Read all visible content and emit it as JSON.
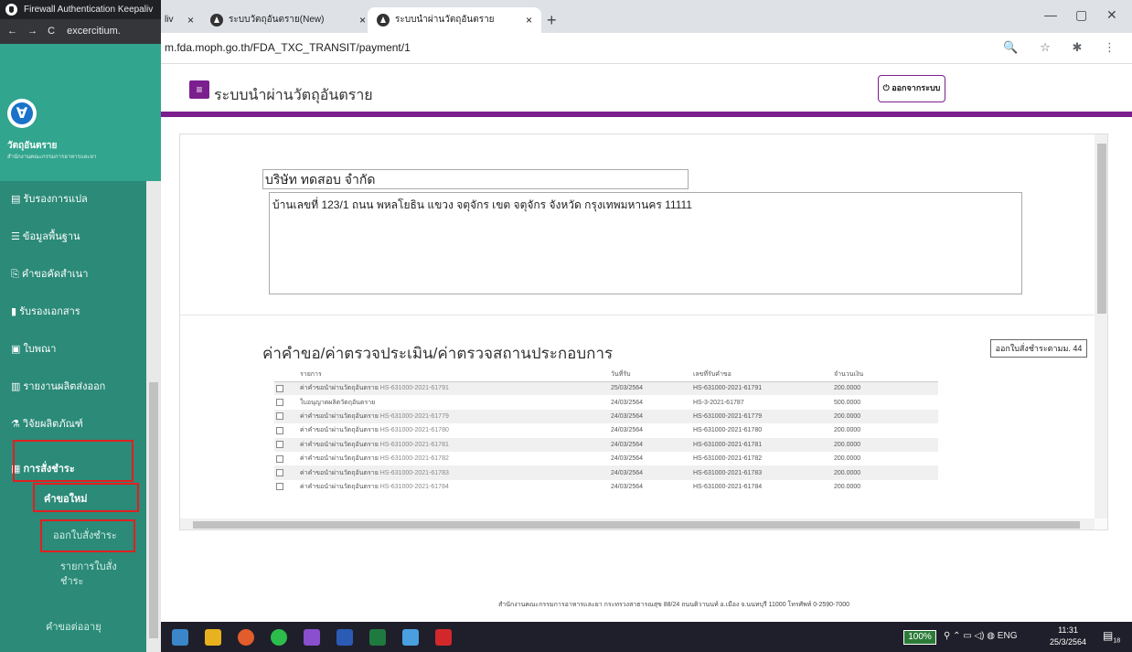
{
  "bg_window": {
    "tab_title": "Firewall Authentication Keepaliv",
    "url_fragment": "excercitium.",
    "brand_title": "วัตถุอันตราย",
    "brand_sub": "สำนักงานคณะกรรมการอาหารและยา",
    "menu": [
      {
        "label": "รับรองการแปล"
      },
      {
        "label": "ข้อมูลพื้นฐาน"
      },
      {
        "label": "คำขอคัดสำเนา"
      },
      {
        "label": "รับรองเอกสาร"
      },
      {
        "label": "ใบพณา"
      },
      {
        "label": "รายงานผลิตส่งออก"
      },
      {
        "label": "วิจัยผลิตภัณฑ์"
      },
      {
        "label": "การสั่งชำระ"
      }
    ],
    "sub_new": "คำขอใหม่",
    "sub_issue": "ออกใบสั่งชำระ",
    "sub_list": "รายการใบสั่งชำระ",
    "sub_renew": "คำขอต่ออายุ"
  },
  "chrome": {
    "tab0": "liv",
    "tab1": "ระบบวัตถุอันตราย(New)",
    "tab2": "ระบบนำผ่านวัตถุอันตราย",
    "url": "m.fda.moph.go.th/FDA_TXC_TRANSIT/payment/1",
    "new_tab": "+",
    "close_x": "×",
    "minimize": "—",
    "restore": "▢",
    "close_window": "✕",
    "toolbar_icons": "🔍 ☆ ✱ ⋮"
  },
  "app": {
    "title": "ระบบนำผ่านวัตถุอันตราย",
    "logout_label": "ออกจากระบบ",
    "company_name": "บริษัท ทดสอบ จำกัด",
    "address": "บ้านเลขที่ 123/1 ถนน พหลโยธิน แขวง จตุจักร เขต จตุจักร จังหวัด กรุงเทพมหานคร 11111",
    "section_title": "ค่าคำขอ/ค่าตรวจประเมิน/ค่าตรวจสถานประกอบการ",
    "print_button": "ออกใบสั่งชำระตามม. 44",
    "table": {
      "headers": [
        "",
        "รายการ",
        "วันที่รับ",
        "เลขที่รับคำขอ",
        "จำนวนเงิน"
      ],
      "rows": [
        {
          "item": "ค่าคำขอนำผ่านวัตถุอันตราย",
          "code": "HS-631000-2021-61791",
          "date": "25/03/2564",
          "ref": "HS-631000-2021-61791",
          "amount": "200.0000"
        },
        {
          "item": "ใบอนุญาตผลิตวัตถุอันตราย",
          "code": "",
          "date": "24/03/2564",
          "ref": "HS-3-2021-61787",
          "amount": "500.0000"
        },
        {
          "item": "ค่าคำขอนำผ่านวัตถุอันตราย",
          "code": "HS-631000-2021-61779",
          "date": "24/03/2564",
          "ref": "HS-631000-2021-61779",
          "amount": "200.0000"
        },
        {
          "item": "ค่าคำขอนำผ่านวัตถุอันตราย",
          "code": "HS-631000-2021-61780",
          "date": "24/03/2564",
          "ref": "HS-631000-2021-61780",
          "amount": "200.0000"
        },
        {
          "item": "ค่าคำขอนำผ่านวัตถุอันตราย",
          "code": "HS-631000-2021-61781",
          "date": "24/03/2564",
          "ref": "HS-631000-2021-61781",
          "amount": "200.0000"
        },
        {
          "item": "ค่าคำขอนำผ่านวัตถุอันตราย",
          "code": "HS-631000-2021-61782",
          "date": "24/03/2564",
          "ref": "HS-631000-2021-61782",
          "amount": "200.0000"
        },
        {
          "item": "ค่าคำขอนำผ่านวัตถุอันตราย",
          "code": "HS-631000-2021-61783",
          "date": "24/03/2564",
          "ref": "HS-631000-2021-61783",
          "amount": "200.0000"
        },
        {
          "item": "ค่าคำขอนำผ่านวัตถุอันตราย",
          "code": "HS-631000-2021-61784",
          "date": "24/03/2564",
          "ref": "HS-631000-2021-61784",
          "amount": "200.0000"
        }
      ]
    },
    "footer": "สำนักงานคณะกรรมการอาหารและยา กระทรวงสาธารณสุข 88/24 ถนนติวานนท์ อ.เมือง จ.นนทบุรี 11000 โทรศัพท์ 0-2590-7000"
  },
  "taskbar": {
    "zoom": "100%",
    "lang": "ENG",
    "time": "11:31",
    "date": "25/3/2564",
    "notif_count": "18"
  },
  "colors": {
    "accent": "#7b1f8f",
    "sidebar_green": "#2b8a78",
    "highlight_red": "#e02020"
  }
}
